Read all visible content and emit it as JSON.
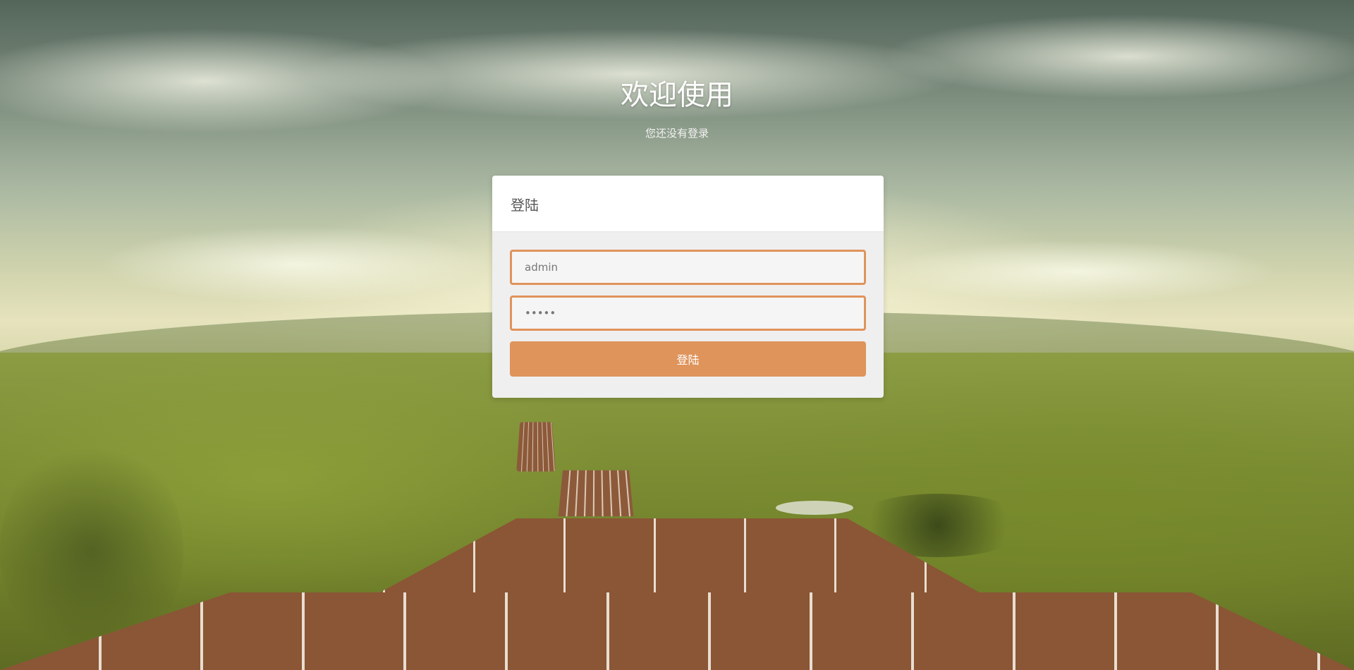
{
  "page": {
    "title": "欢迎使用",
    "subtitle": "您还没有登录"
  },
  "login_panel": {
    "heading": "登陆",
    "username": {
      "value": "admin",
      "placeholder": "admin"
    },
    "password": {
      "value": "•••••"
    },
    "submit_label": "登陆"
  },
  "colors": {
    "accent": "#df945b",
    "input_border": "#e0935b",
    "panel_body": "#efefef"
  }
}
